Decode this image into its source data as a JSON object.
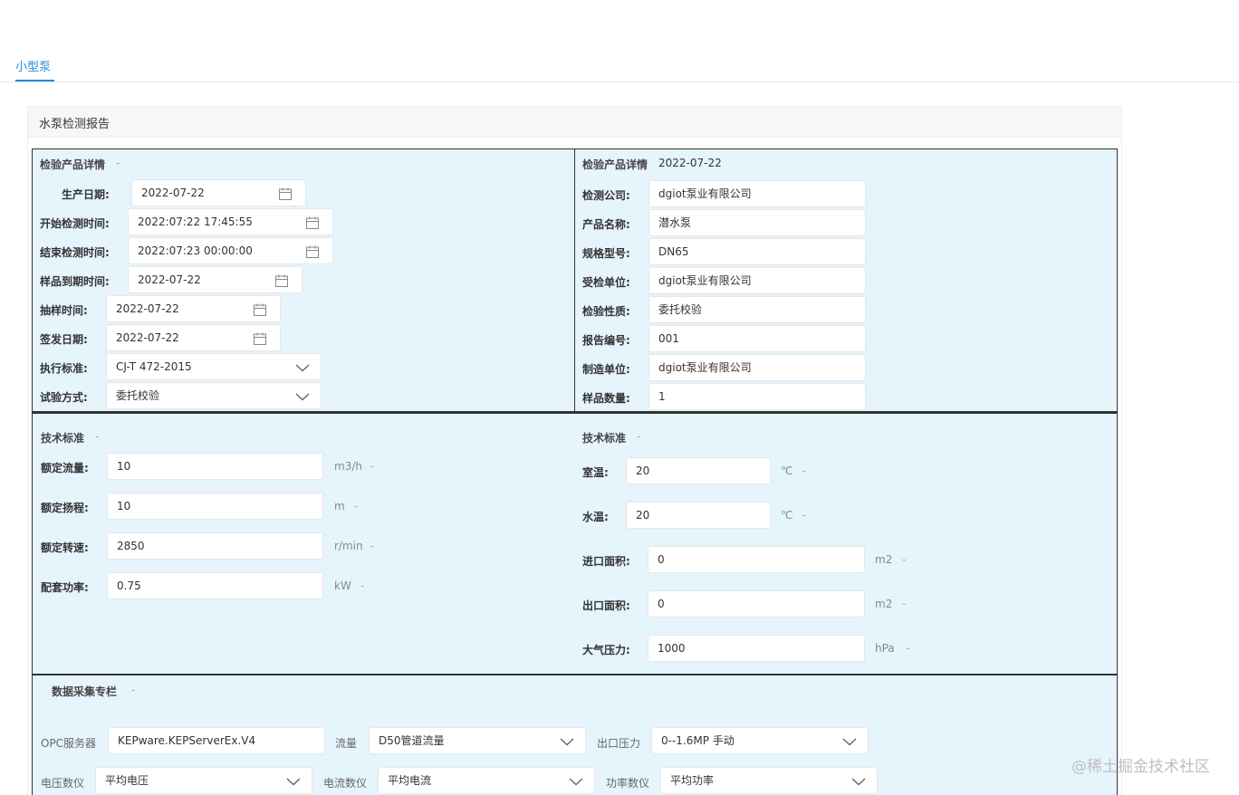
{
  "tabs": {
    "active": "小型泵"
  },
  "card": {
    "title": "水泵检测报告"
  },
  "product_left": {
    "section_title": "检验产品详情",
    "section_dash": "-",
    "fields": [
      {
        "label": "生产日期:",
        "value": "2022-07-22"
      },
      {
        "label": "开始检测时间:",
        "value": "2022:07:22 17:45:55"
      },
      {
        "label": "结束检测时间:",
        "value": "2022:07:23 00:00:00"
      },
      {
        "label": "样品到期时间:",
        "value": "2022-07-22"
      },
      {
        "label": "抽样时间:",
        "value": "2022-07-22"
      },
      {
        "label": "签发日期:",
        "value": "2022-07-22"
      },
      {
        "label": "执行标准:",
        "value": "CJ-T 472-2015"
      },
      {
        "label": "试验方式:",
        "value": "委托校验"
      }
    ]
  },
  "product_right": {
    "section_title": "检验产品详情",
    "section_value": "2022-07-22",
    "fields": [
      {
        "label": "检测公司:",
        "value": "dgiot泵业有限公司"
      },
      {
        "label": "产品名称:",
        "value": "潜水泵"
      },
      {
        "label": "规格型号:",
        "value": "DN65"
      },
      {
        "label": "受检单位:",
        "value": "dgiot泵业有限公司"
      },
      {
        "label": "检验性质:",
        "value": "委托校验"
      },
      {
        "label": "报告编号:",
        "value": "001"
      },
      {
        "label": "制造单位:",
        "value": "dgiot泵业有限公司"
      },
      {
        "label": "样品数量:",
        "value": "1"
      }
    ]
  },
  "tech_left": {
    "section_title": "技术标准",
    "section_dash": "-",
    "fields": [
      {
        "label": "额定流量:",
        "value": "10",
        "unit": "m3/h",
        "dash": "-"
      },
      {
        "label": "额定扬程:",
        "value": "10",
        "unit": "m",
        "dash": "-"
      },
      {
        "label": "额定转速:",
        "value": "2850",
        "unit": "r/min",
        "dash": "-"
      },
      {
        "label": "配套功率:",
        "value": "0.75",
        "unit": "kW",
        "dash": "-"
      }
    ]
  },
  "tech_right": {
    "section_title": "技术标准",
    "section_dash": "-",
    "fields": [
      {
        "label": "室温:",
        "value": "20",
        "unit": "℃",
        "dash": "-"
      },
      {
        "label": "水温:",
        "value": "20",
        "unit": "℃",
        "dash": "-"
      },
      {
        "label": "进口面积:",
        "value": "0",
        "unit": "m2",
        "dash": "-"
      },
      {
        "label": "出口面积:",
        "value": "0",
        "unit": "m2",
        "dash": "-"
      },
      {
        "label": "大气压力:",
        "value": "1000",
        "unit": "hPa",
        "dash": "-"
      }
    ]
  },
  "data_collection": {
    "section_title": "数据采集专栏",
    "section_dash": "-",
    "opc_label": "OPC服务器",
    "opc_value": "KEPware.KEPServerEx.V4",
    "flow_label": "流量",
    "flow_value": "D50管道流量",
    "outlet_pressure_label": "出口压力",
    "outlet_pressure_value": "0--1.6MP 手动",
    "voltage_label": "电压数仪",
    "voltage_value": "平均电压",
    "current_label": "电流数仪",
    "current_value": "平均电流",
    "power_label": "功率数仪",
    "power_value": "平均功率"
  },
  "watermark": "@稀土掘金技术社区",
  "icons": {
    "calendar": "calendar-icon",
    "dropdown": "chevron-down-icon"
  },
  "colors": {
    "accent": "#1f8fdc",
    "panel_bg": "#e6f4fc"
  }
}
